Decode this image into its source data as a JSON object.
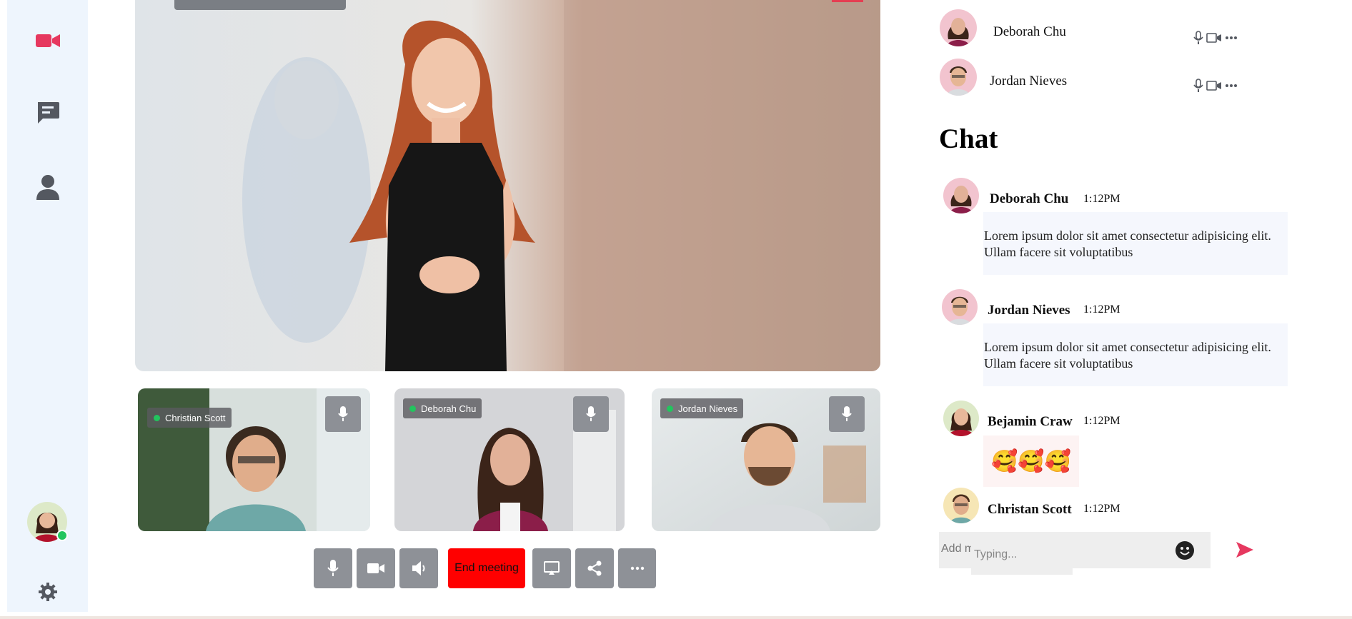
{
  "nav": {
    "items": [
      {
        "name": "video-call",
        "icon": "video-camera-icon",
        "active": true
      },
      {
        "name": "chat",
        "icon": "chat-bubble-icon"
      },
      {
        "name": "profile",
        "icon": "user-icon"
      }
    ],
    "settings_icon": "gear-icon",
    "accent": "#e6385f",
    "icon_color": "#545860"
  },
  "participants_list": [
    {
      "name": "Deborah Chu"
    },
    {
      "name": "Jordan Nieves"
    }
  ],
  "thumbnails": [
    {
      "name": "Christian Scott"
    },
    {
      "name": "Deborah Chu"
    },
    {
      "name": "Jordan Nieves"
    }
  ],
  "controls": {
    "end_meeting_label": "End meeting",
    "end_meeting_color": "#ff0000"
  },
  "chat": {
    "title": "Chat",
    "messages": [
      {
        "author": "Deborah Chu",
        "time": "1:12PM",
        "text": "Lorem ipsum dolor sit amet consectetur adipisicing elit. Ullam facere sit voluptatibus"
      },
      {
        "author": "Jordan Nieves",
        "time": "1:12PM",
        "text": "Lorem ipsum dolor sit amet consectetur adipisicing elit. Ullam facere sit voluptatibus"
      },
      {
        "author": "Bejamin Craw",
        "time": "1:12PM",
        "emojis": "🥰🥰🥰"
      },
      {
        "author": "Christan Scott",
        "time": "1:12PM"
      }
    ],
    "input_placeholder": "Add message",
    "typing_placeholder": "Typing...",
    "send_color": "#e6385f"
  }
}
